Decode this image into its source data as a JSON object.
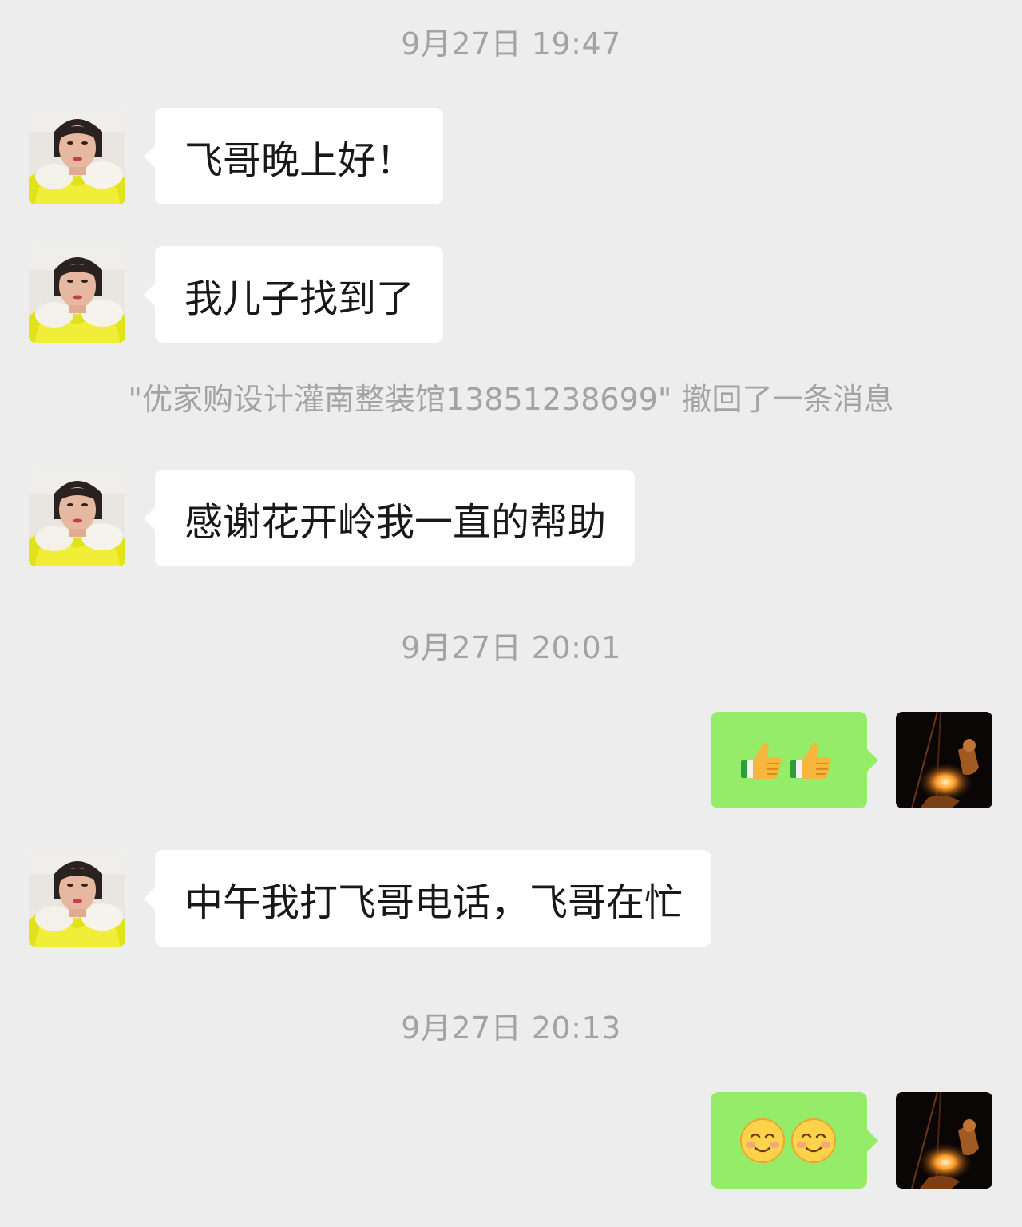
{
  "chat": {
    "timestamps": [
      "9月27日 19:47",
      "9月27日 20:01",
      "9月27日 20:13"
    ],
    "recall_notice": "\"优家购设计灌南整装馆13851238699\" 撤回了一条消息",
    "messages": [
      {
        "side": "left",
        "text": "飞哥晚上好！"
      },
      {
        "side": "left",
        "text": "我儿子找到了"
      },
      {
        "side": "left",
        "text": "感谢花开岭我一直的帮助"
      },
      {
        "side": "right",
        "emoji": [
          "thumbs-up",
          "thumbs-up"
        ]
      },
      {
        "side": "left",
        "text": "中午我打飞哥电话，飞哥在忙"
      },
      {
        "side": "right",
        "emoji": [
          "smiling-face",
          "smiling-face"
        ]
      }
    ]
  },
  "colors": {
    "background": "#ededed",
    "bubble_in": "#ffffff",
    "bubble_out": "#95ec69",
    "meta_text": "#a3a3a3"
  }
}
